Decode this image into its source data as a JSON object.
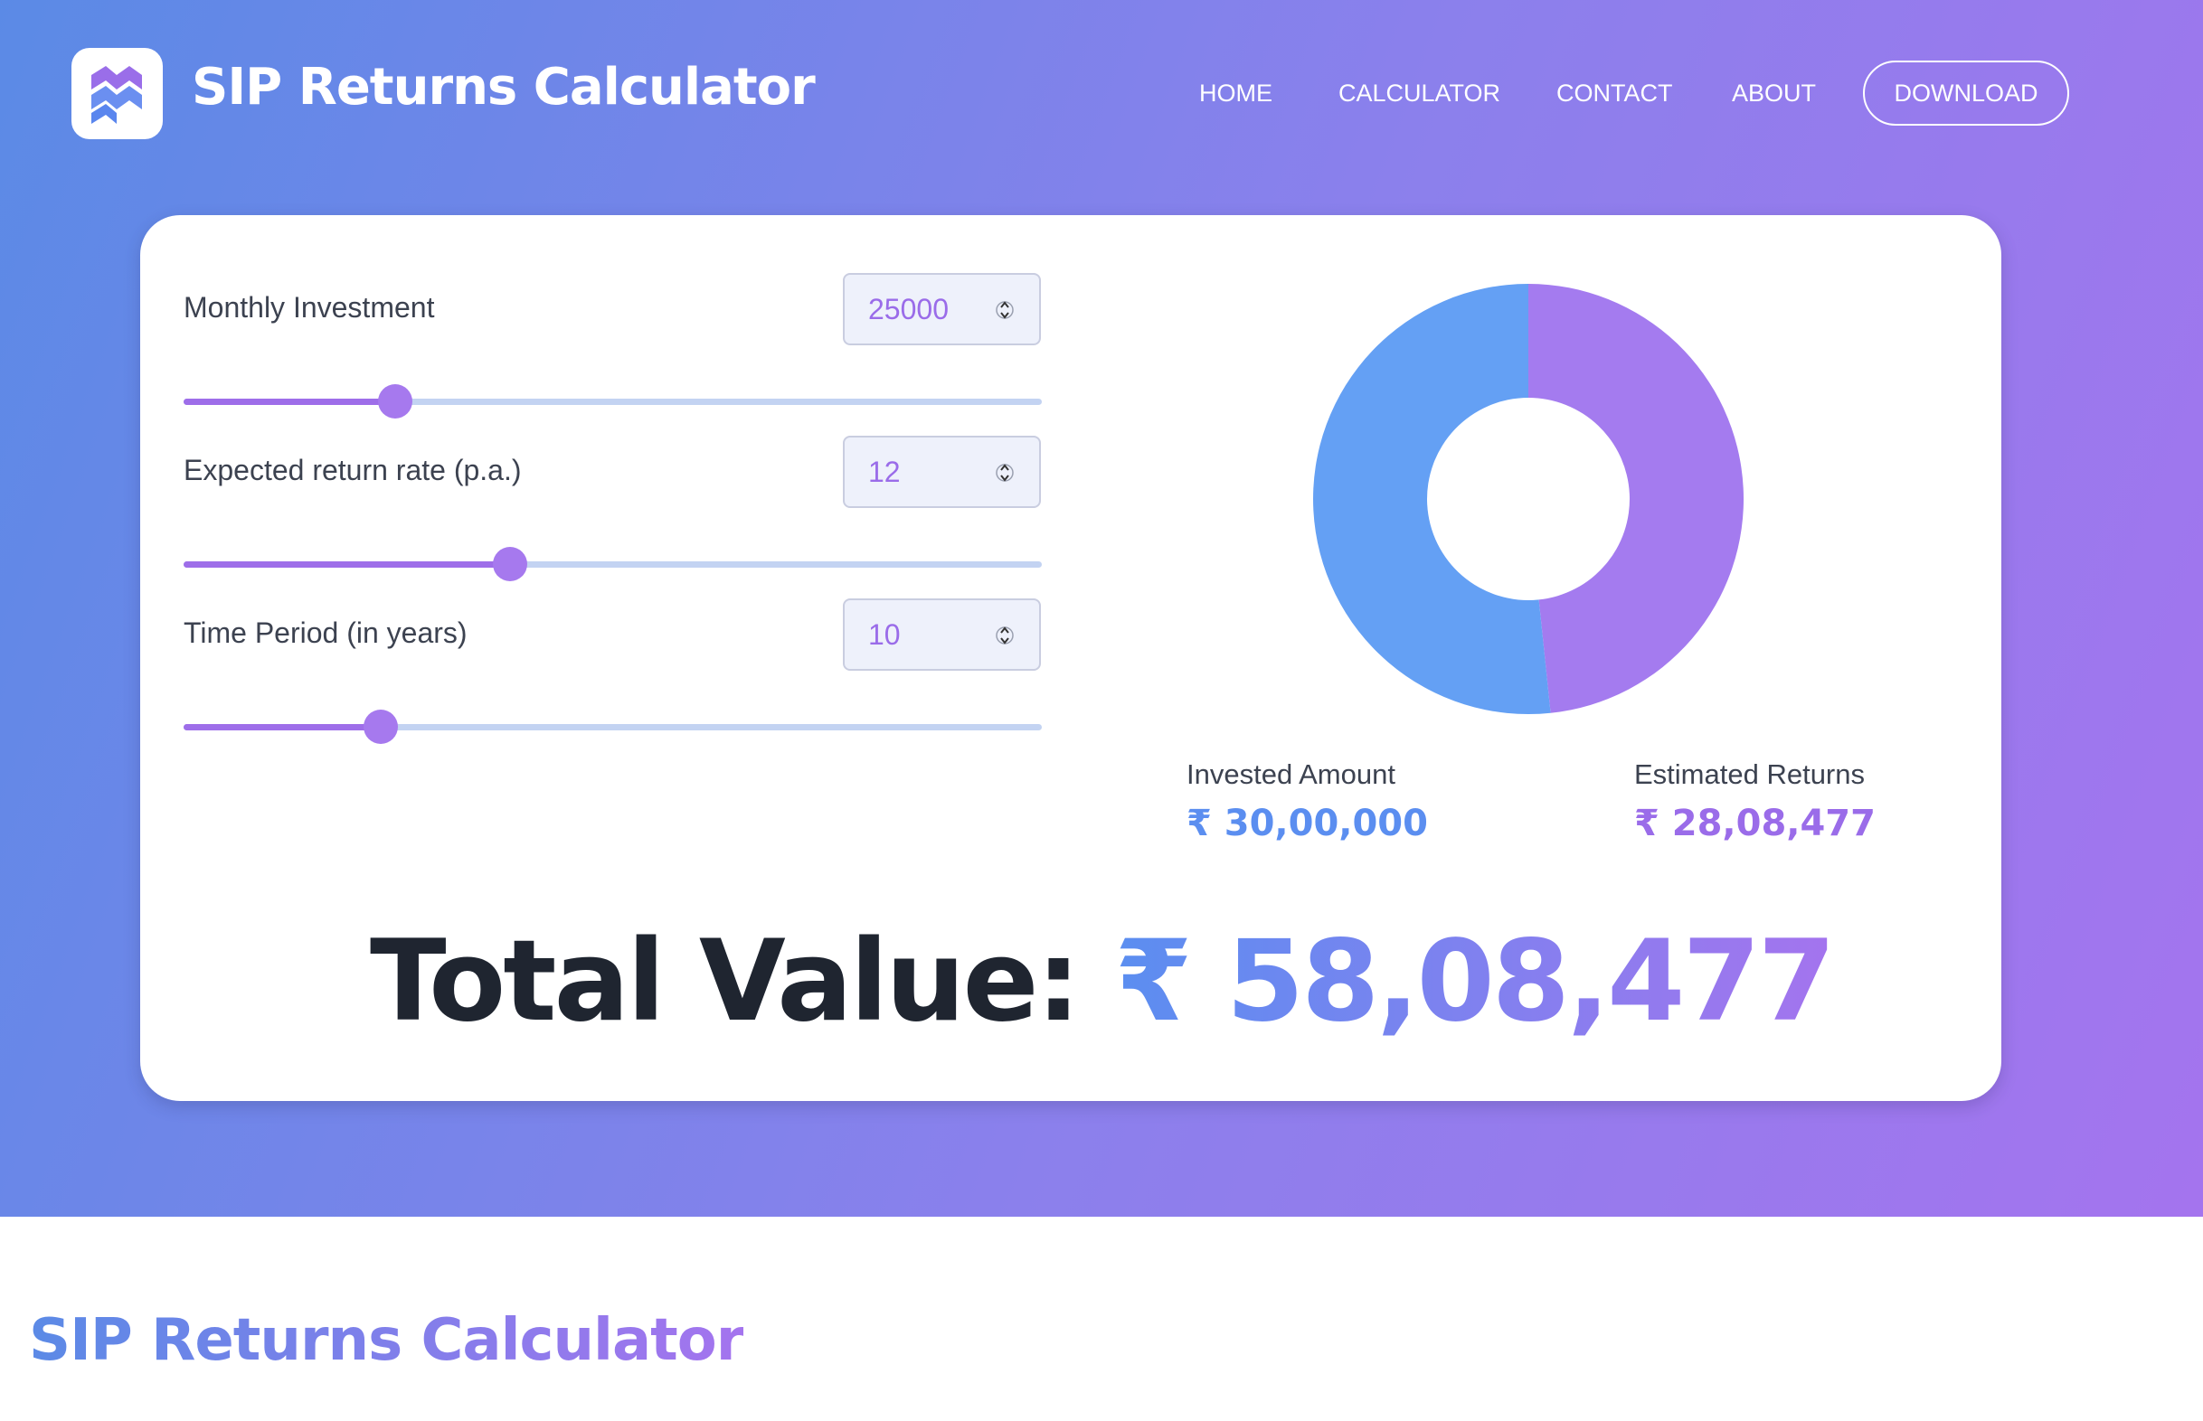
{
  "header": {
    "brand": "SIP Returns Calculator",
    "nav": {
      "home": "HOME",
      "calculator": "CALCULATOR",
      "contact": "CONTACT",
      "about": "ABOUT",
      "download": "DOWNLOAD"
    }
  },
  "calculator": {
    "monthly_investment": {
      "label": "Monthly Investment",
      "value": "25000",
      "slider_fraction": 0.247
    },
    "return_rate": {
      "label": "Expected return rate (p.a.)",
      "value": "12",
      "slider_fraction": 0.38
    },
    "time_period": {
      "label": "Time Period (in years)",
      "value": "10",
      "slider_fraction": 0.23
    }
  },
  "chart_data": {
    "type": "pie",
    "style": "donut",
    "categories": [
      "Invested Amount",
      "Estimated Returns"
    ],
    "values": [
      3000000,
      2808477
    ],
    "colors": [
      "#64a0f4",
      "#a47bef"
    ]
  },
  "summary": {
    "invested_label": "Invested Amount",
    "invested_value": "₹ 30,00,000",
    "returns_label": "Estimated Returns",
    "returns_value": "₹ 28,08,477",
    "total_label": "Total Value:",
    "total_value": "₹ 58,08,477"
  },
  "section": {
    "title": "SIP Returns Calculator"
  },
  "colors": {
    "gradient_start": "#5b8ae6",
    "gradient_end": "#a474ee",
    "invested": "#64a0f4",
    "returns": "#a47bef",
    "input_text": "#9a6ce9"
  }
}
